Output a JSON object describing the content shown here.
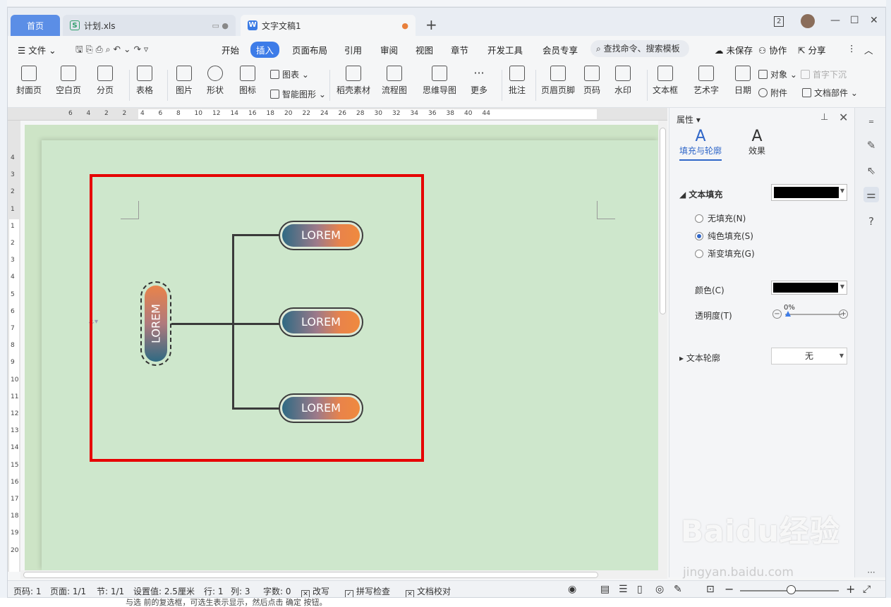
{
  "tabs": {
    "home": "首页",
    "xls": "计划.xls",
    "doc": "文字文稿1",
    "add": "+"
  },
  "window": {
    "badge": "2",
    "minimize": "—",
    "maximize": "☐",
    "close": "✕"
  },
  "menu": {
    "file": "文件",
    "items": [
      "开始",
      "插入",
      "页面布局",
      "引用",
      "审阅",
      "视图",
      "章节",
      "开发工具",
      "会员专享"
    ],
    "active": "插入",
    "search_placeholder": "查找命令、搜索模板",
    "unsaved": "未保存",
    "collab": "协作",
    "share": "分享"
  },
  "ribbon": {
    "cover": "封面页",
    "blank": "空白页",
    "pagebreak": "分页",
    "table": "表格",
    "picture": "图片",
    "shape": "形状",
    "icon": "图标",
    "chart": "图表",
    "smartart": "智能图形",
    "material": "稻壳素材",
    "flowchart": "流程图",
    "mindmap": "思维导图",
    "more": "更多",
    "comment": "批注",
    "header_footer": "页眉页脚",
    "page_num": "页码",
    "watermark": "水印",
    "textbox": "文本框",
    "wordart": "艺术字",
    "date": "日期",
    "object": "对象",
    "dropcap": "首字下沉",
    "attachment": "附件",
    "docparts": "文档部件"
  },
  "ruler": {
    "h_marks": [
      "6",
      "4",
      "2",
      "2",
      "4",
      "6",
      "8",
      "10",
      "12",
      "14",
      "16",
      "18",
      "20",
      "22",
      "24",
      "26",
      "28",
      "30",
      "32",
      "34",
      "36",
      "38",
      "40",
      "44"
    ],
    "v_marks": [
      "4",
      "3",
      "2",
      "1",
      "1",
      "2",
      "3",
      "4",
      "5",
      "6",
      "7",
      "8",
      "9",
      "10",
      "11",
      "12",
      "13",
      "14",
      "15",
      "16",
      "17",
      "18",
      "19",
      "20"
    ]
  },
  "diagram": {
    "root": "LOREM",
    "children": [
      "LOREM",
      "LOREM",
      "LOREM"
    ],
    "highlight_color": "#e60000"
  },
  "panel": {
    "title": "属性",
    "tab_fill": "填充与轮廓",
    "tab_effect": "效果",
    "text_fill": "文本填充",
    "no_fill": "无填充(N)",
    "solid_fill": "纯色填充(S)",
    "gradient_fill": "渐变填充(G)",
    "color": "颜色(C)",
    "transparency": "透明度(T)",
    "transparency_value": "0%",
    "text_outline": "文本轮廓",
    "outline_value": "无",
    "fill_color": "#000000"
  },
  "status": {
    "page_num": "页码: 1",
    "pages": "页面: 1/1",
    "section": "节: 1/1",
    "setting": "设置值: 2.5厘米",
    "row": "行: 1",
    "col": "列: 3",
    "words": "字数: 0",
    "revise": "改写",
    "spellcheck": "拼写检查",
    "proofread": "文档校对"
  },
  "background_text": "与选     前的复选框，可选生表示显示，然后点击 确定 按钮。",
  "watermark": {
    "brand": "Baidu经验",
    "url": "jingyan.baidu.com"
  }
}
